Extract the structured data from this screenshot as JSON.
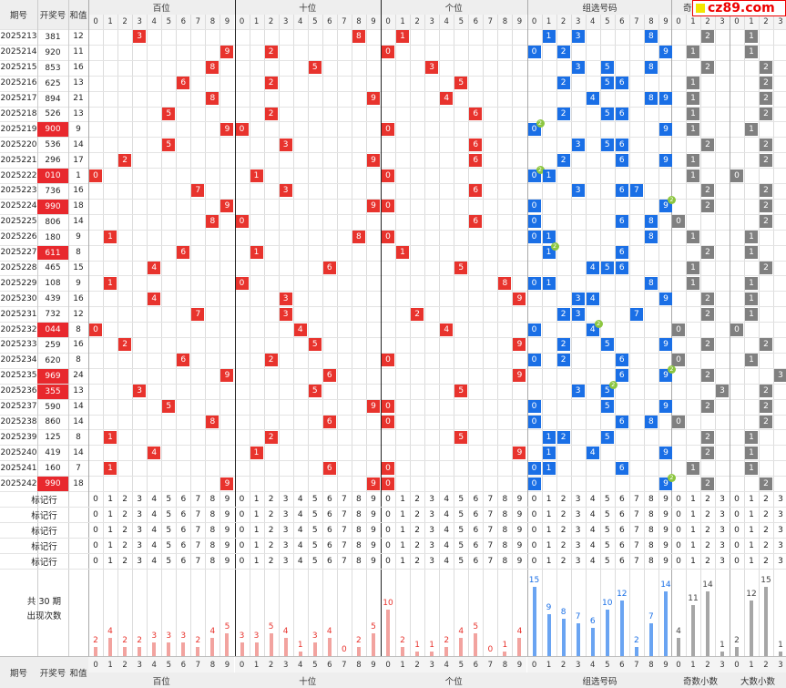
{
  "header": {
    "col_period": "期号",
    "col_open": "开奖号",
    "col_sum": "和值",
    "groups": [
      "百位",
      "十位",
      "个位",
      "组选号码",
      "奇数小数",
      "大数小数"
    ]
  },
  "logo": {
    "text": "cz89.com",
    "icon": "yellow-square-icon"
  },
  "digits": [
    "0",
    "1",
    "2",
    "3",
    "4",
    "5",
    "6",
    "7",
    "8",
    "9"
  ],
  "small_labels": [
    "0",
    "1",
    "2",
    "3"
  ],
  "rows": [
    {
      "period": "2025213",
      "open": "381",
      "sum": "12",
      "hl": false,
      "bai": 3,
      "shi": 8,
      "ge": 1,
      "grp": [
        1,
        3,
        8
      ],
      "rep": null,
      "odd": 2,
      "big": 1
    },
    {
      "period": "2025214",
      "open": "920",
      "sum": "11",
      "hl": false,
      "bai": 9,
      "shi": 2,
      "ge": 0,
      "grp": [
        0,
        2,
        9
      ],
      "rep": null,
      "odd": 1,
      "big": 1
    },
    {
      "period": "2025215",
      "open": "853",
      "sum": "16",
      "hl": false,
      "bai": 8,
      "shi": 5,
      "ge": 3,
      "grp": [
        3,
        5,
        8
      ],
      "rep": null,
      "odd": 2,
      "big": 2
    },
    {
      "period": "2025216",
      "open": "625",
      "sum": "13",
      "hl": false,
      "bai": 6,
      "shi": 2,
      "ge": 5,
      "grp": [
        2,
        5,
        6
      ],
      "rep": null,
      "odd": 1,
      "big": 2
    },
    {
      "period": "2025217",
      "open": "894",
      "sum": "21",
      "hl": false,
      "bai": 8,
      "shi": 9,
      "ge": 4,
      "grp": [
        4,
        8,
        9
      ],
      "rep": null,
      "odd": 1,
      "big": 2
    },
    {
      "period": "2025218",
      "open": "526",
      "sum": "13",
      "hl": false,
      "bai": 5,
      "shi": 2,
      "ge": 6,
      "grp": [
        2,
        5,
        6
      ],
      "rep": null,
      "odd": 1,
      "big": 2
    },
    {
      "period": "2025219",
      "open": "900",
      "sum": "9",
      "hl": true,
      "bai": 9,
      "shi": 0,
      "ge": 0,
      "grp": [
        0,
        9
      ],
      "rep": 0,
      "odd": 1,
      "big": 1
    },
    {
      "period": "2025220",
      "open": "536",
      "sum": "14",
      "hl": false,
      "bai": 5,
      "shi": 3,
      "ge": 6,
      "grp": [
        3,
        5,
        6
      ],
      "rep": null,
      "odd": 2,
      "big": 2
    },
    {
      "period": "2025221",
      "open": "296",
      "sum": "17",
      "hl": false,
      "bai": 2,
      "shi": 9,
      "ge": 6,
      "grp": [
        2,
        6,
        9
      ],
      "rep": null,
      "odd": 1,
      "big": 2
    },
    {
      "period": "2025222",
      "open": "010",
      "sum": "1",
      "hl": true,
      "bai": 0,
      "shi": 1,
      "ge": 0,
      "grp": [
        0,
        1
      ],
      "rep": 0,
      "odd": 1,
      "big": 0
    },
    {
      "period": "2025223",
      "open": "736",
      "sum": "16",
      "hl": false,
      "bai": 7,
      "shi": 3,
      "ge": 6,
      "grp": [
        3,
        6,
        7
      ],
      "rep": null,
      "odd": 2,
      "big": 2
    },
    {
      "period": "2025224",
      "open": "990",
      "sum": "18",
      "hl": true,
      "bai": 9,
      "shi": 9,
      "ge": 0,
      "grp": [
        0,
        9
      ],
      "rep": 9,
      "odd": 2,
      "big": 2
    },
    {
      "period": "2025225",
      "open": "806",
      "sum": "14",
      "hl": false,
      "bai": 8,
      "shi": 0,
      "ge": 6,
      "grp": [
        0,
        6,
        8
      ],
      "rep": null,
      "odd": 0,
      "big": 2
    },
    {
      "period": "2025226",
      "open": "180",
      "sum": "9",
      "hl": false,
      "bai": 1,
      "shi": 8,
      "ge": 0,
      "grp": [
        0,
        1,
        8
      ],
      "rep": null,
      "odd": 1,
      "big": 1
    },
    {
      "period": "2025227",
      "open": "611",
      "sum": "8",
      "hl": true,
      "bai": 6,
      "shi": 1,
      "ge": 1,
      "grp": [
        1,
        6
      ],
      "rep": 1,
      "odd": 2,
      "big": 1
    },
    {
      "period": "2025228",
      "open": "465",
      "sum": "15",
      "hl": false,
      "bai": 4,
      "shi": 6,
      "ge": 5,
      "grp": [
        4,
        5,
        6
      ],
      "rep": null,
      "odd": 1,
      "big": 2
    },
    {
      "period": "2025229",
      "open": "108",
      "sum": "9",
      "hl": false,
      "bai": 1,
      "shi": 0,
      "ge": 8,
      "grp": [
        0,
        1,
        8
      ],
      "rep": null,
      "odd": 1,
      "big": 1
    },
    {
      "period": "2025230",
      "open": "439",
      "sum": "16",
      "hl": false,
      "bai": 4,
      "shi": 3,
      "ge": 9,
      "grp": [
        3,
        4,
        9
      ],
      "rep": null,
      "odd": 2,
      "big": 1
    },
    {
      "period": "2025231",
      "open": "732",
      "sum": "12",
      "hl": false,
      "bai": 7,
      "shi": 3,
      "ge": 2,
      "grp": [
        2,
        3,
        7
      ],
      "rep": null,
      "odd": 2,
      "big": 1
    },
    {
      "period": "2025232",
      "open": "044",
      "sum": "8",
      "hl": true,
      "bai": 0,
      "shi": 4,
      "ge": 4,
      "grp": [
        0,
        4
      ],
      "rep": 4,
      "odd": 0,
      "big": 0
    },
    {
      "period": "2025233",
      "open": "259",
      "sum": "16",
      "hl": false,
      "bai": 2,
      "shi": 5,
      "ge": 9,
      "grp": [
        2,
        5,
        9
      ],
      "rep": null,
      "odd": 2,
      "big": 2
    },
    {
      "period": "2025234",
      "open": "620",
      "sum": "8",
      "hl": false,
      "bai": 6,
      "shi": 2,
      "ge": 0,
      "grp": [
        0,
        2,
        6
      ],
      "rep": null,
      "odd": 0,
      "big": 1
    },
    {
      "period": "2025235",
      "open": "969",
      "sum": "24",
      "hl": true,
      "bai": 9,
      "shi": 6,
      "ge": 9,
      "grp": [
        6,
        9
      ],
      "rep": 9,
      "odd": 2,
      "big": 3
    },
    {
      "period": "2025236",
      "open": "355",
      "sum": "13",
      "hl": true,
      "bai": 3,
      "shi": 5,
      "ge": 5,
      "grp": [
        3,
        5
      ],
      "rep": 5,
      "odd": 3,
      "big": 2
    },
    {
      "period": "2025237",
      "open": "590",
      "sum": "14",
      "hl": false,
      "bai": 5,
      "shi": 9,
      "ge": 0,
      "grp": [
        0,
        5,
        9
      ],
      "rep": null,
      "odd": 2,
      "big": 2
    },
    {
      "period": "2025238",
      "open": "860",
      "sum": "14",
      "hl": false,
      "bai": 8,
      "shi": 6,
      "ge": 0,
      "grp": [
        0,
        6,
        8
      ],
      "rep": null,
      "odd": 0,
      "big": 2
    },
    {
      "period": "2025239",
      "open": "125",
      "sum": "8",
      "hl": false,
      "bai": 1,
      "shi": 2,
      "ge": 5,
      "grp": [
        1,
        2,
        5
      ],
      "rep": null,
      "odd": 2,
      "big": 1
    },
    {
      "period": "2025240",
      "open": "419",
      "sum": "14",
      "hl": false,
      "bai": 4,
      "shi": 1,
      "ge": 9,
      "grp": [
        1,
        4,
        9
      ],
      "rep": null,
      "odd": 2,
      "big": 1
    },
    {
      "period": "2025241",
      "open": "160",
      "sum": "7",
      "hl": false,
      "bai": 1,
      "shi": 6,
      "ge": 0,
      "grp": [
        0,
        1,
        6
      ],
      "rep": null,
      "odd": 1,
      "big": 1
    },
    {
      "period": "2025242",
      "open": "990",
      "sum": "18",
      "hl": true,
      "bai": 9,
      "shi": 9,
      "ge": 0,
      "grp": [
        0,
        9
      ],
      "rep": 9,
      "odd": 2,
      "big": 2
    }
  ],
  "mark_rows": {
    "label": "标记行",
    "count": 5
  },
  "summary": {
    "line1": "共 30 期",
    "line2": "出现次数",
    "counts": {
      "bai": [
        2,
        4,
        2,
        2,
        3,
        3,
        3,
        2,
        4,
        5
      ],
      "shi": [
        3,
        3,
        5,
        4,
        1,
        3,
        4,
        0,
        2,
        5
      ],
      "ge": [
        10,
        2,
        1,
        1,
        2,
        4,
        5,
        0,
        1,
        4
      ],
      "grp": [
        15,
        9,
        8,
        7,
        6,
        10,
        12,
        2,
        7,
        14
      ],
      "odd": [
        4,
        11,
        14,
        1
      ],
      "big": [
        2,
        12,
        15,
        1
      ]
    }
  },
  "colors": {
    "red": "#e8332d",
    "blue": "#1a6fe6",
    "gray": "#808080",
    "bar_red": "#f2a39f",
    "bar_blue": "#6aa4f2",
    "bar_gray": "#a6a6a6",
    "badge": "#8cc63f"
  }
}
